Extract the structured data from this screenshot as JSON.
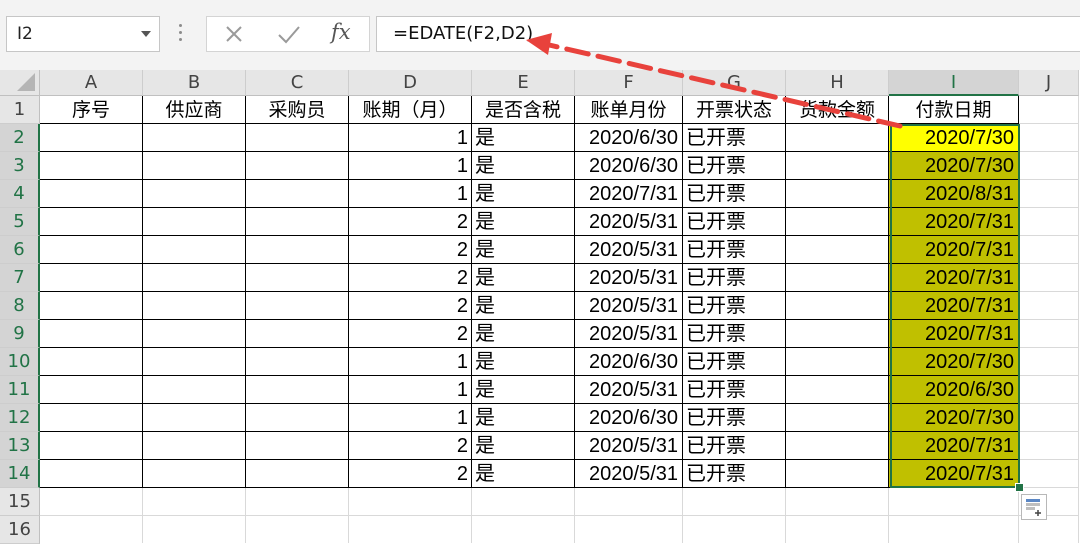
{
  "formula_bar": {
    "name_box": "I2",
    "fx_label": "fx",
    "formula": "=EDATE(F2,D2)"
  },
  "columns": [
    "A",
    "B",
    "C",
    "D",
    "E",
    "F",
    "G",
    "H",
    "I",
    "J"
  ],
  "selected_column": "I",
  "rows": [
    "1",
    "2",
    "3",
    "4",
    "5",
    "6",
    "7",
    "8",
    "9",
    "10",
    "11",
    "12",
    "13",
    "14",
    "15",
    "16"
  ],
  "selected_rows": [
    "2",
    "3",
    "4",
    "5",
    "6",
    "7",
    "8",
    "9",
    "10",
    "11",
    "12",
    "13",
    "14"
  ],
  "headers": [
    "序号",
    "供应商",
    "采购员",
    "账期（月）",
    "是否含税",
    "账单月份",
    "开票状态",
    "货款金额",
    "付款日期"
  ],
  "data_rows": [
    {
      "period": "1",
      "tax": "是",
      "bill_month": "2020/6/30",
      "invoice": "已开票",
      "pay_date": "2020/7/30"
    },
    {
      "period": "1",
      "tax": "是",
      "bill_month": "2020/6/30",
      "invoice": "已开票",
      "pay_date": "2020/7/30"
    },
    {
      "period": "1",
      "tax": "是",
      "bill_month": "2020/7/31",
      "invoice": "已开票",
      "pay_date": "2020/8/31"
    },
    {
      "period": "2",
      "tax": "是",
      "bill_month": "2020/5/31",
      "invoice": "已开票",
      "pay_date": "2020/7/31"
    },
    {
      "period": "2",
      "tax": "是",
      "bill_month": "2020/5/31",
      "invoice": "已开票",
      "pay_date": "2020/7/31"
    },
    {
      "period": "2",
      "tax": "是",
      "bill_month": "2020/5/31",
      "invoice": "已开票",
      "pay_date": "2020/7/31"
    },
    {
      "period": "2",
      "tax": "是",
      "bill_month": "2020/5/31",
      "invoice": "已开票",
      "pay_date": "2020/7/31"
    },
    {
      "period": "2",
      "tax": "是",
      "bill_month": "2020/5/31",
      "invoice": "已开票",
      "pay_date": "2020/7/31"
    },
    {
      "period": "1",
      "tax": "是",
      "bill_month": "2020/6/30",
      "invoice": "已开票",
      "pay_date": "2020/7/30"
    },
    {
      "period": "1",
      "tax": "是",
      "bill_month": "2020/5/31",
      "invoice": "已开票",
      "pay_date": "2020/6/30"
    },
    {
      "period": "1",
      "tax": "是",
      "bill_month": "2020/6/30",
      "invoice": "已开票",
      "pay_date": "2020/7/30"
    },
    {
      "period": "2",
      "tax": "是",
      "bill_month": "2020/5/31",
      "invoice": "已开票",
      "pay_date": "2020/7/31"
    },
    {
      "period": "2",
      "tax": "是",
      "bill_month": "2020/5/31",
      "invoice": "已开票",
      "pay_date": "2020/7/31"
    }
  ],
  "colors": {
    "active_cell_fill": "#ffff00",
    "selection_fill": "#c0c000",
    "selection_border": "#217346",
    "annotation_arrow": "#e8423c"
  },
  "icons": {
    "cancel": "close-icon",
    "enter": "check-icon",
    "function": "fx-icon",
    "quick_analysis": "quick-analysis-icon"
  }
}
